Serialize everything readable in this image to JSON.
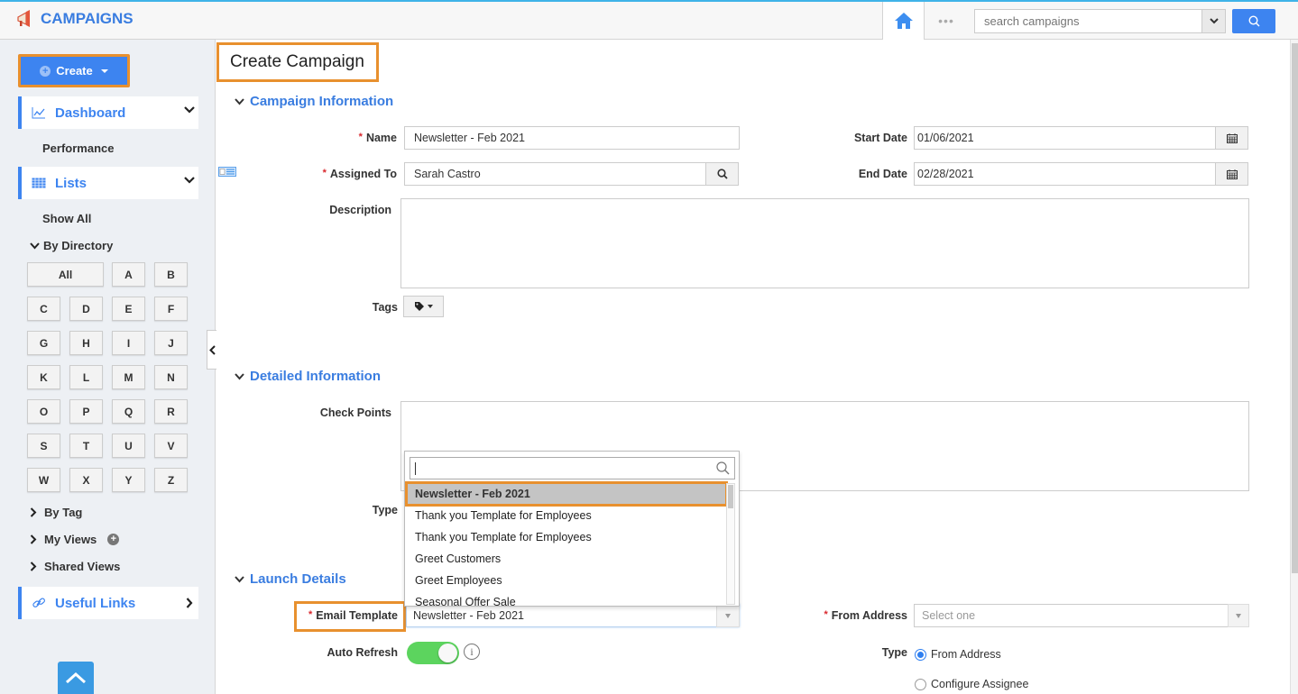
{
  "app": {
    "title": "CAMPAIGNS",
    "icon": "megaphone-icon"
  },
  "topbar": {
    "home_icon": "home-icon",
    "more_icon": "ellipsis-icon",
    "more_label": "•••",
    "search_placeholder": "search campaigns",
    "search_value": "",
    "search_dropdown_icon": "chevron-down-icon",
    "search_button_icon": "search-icon"
  },
  "sidebar": {
    "create_label": "Create",
    "sections": [
      {
        "label": "Dashboard",
        "icon": "line-chart-icon",
        "expanded": true,
        "items": [
          "Performance"
        ]
      },
      {
        "label": "Lists",
        "icon": "grid-table-icon",
        "expanded": true,
        "items": [
          "Show All"
        ]
      }
    ],
    "by_directory_label": "By Directory",
    "letters": [
      "All",
      "A",
      "B",
      "C",
      "D",
      "E",
      "F",
      "G",
      "H",
      "I",
      "J",
      "K",
      "L",
      "M",
      "N",
      "O",
      "P",
      "Q",
      "R",
      "S",
      "T",
      "U",
      "V",
      "W",
      "X",
      "Y",
      "Z"
    ],
    "tree_items": [
      {
        "label": "By Tag"
      },
      {
        "label": "My Views",
        "has_add": true
      },
      {
        "label": "Shared Views"
      }
    ],
    "useful_links_label": "Useful Links",
    "useful_links_icon": "link-icon"
  },
  "main": {
    "page_title": "Create Campaign",
    "sections": {
      "campaign_info": "Campaign Information",
      "detailed_info": "Detailed Information",
      "launch_details": "Launch Details"
    },
    "fields": {
      "name": {
        "label": "Name",
        "required": true,
        "value": "Newsletter - Feb 2021"
      },
      "assigned_to": {
        "label": "Assigned To",
        "required": true,
        "value": "Sarah Castro"
      },
      "start_date": {
        "label": "Start Date",
        "value": "01/06/2021"
      },
      "end_date": {
        "label": "End Date",
        "value": "02/28/2021"
      },
      "description": {
        "label": "Description",
        "value": ""
      },
      "tags": {
        "label": "Tags"
      },
      "check_points": {
        "label": "Check Points",
        "value": ""
      },
      "type": {
        "label": "Type"
      },
      "email_template": {
        "label": "Email Template",
        "required": true,
        "value": "Newsletter - Feb 2021"
      },
      "from_address": {
        "label": "From Address",
        "required": true,
        "placeholder": "Select one"
      },
      "auto_refresh": {
        "label": "Auto Refresh",
        "enabled": true
      },
      "from_type": {
        "label": "Type",
        "options": [
          {
            "label": "From Address",
            "selected": true
          },
          {
            "label": "Configure Assignee",
            "selected": false
          }
        ]
      }
    },
    "template_dropdown": {
      "search_value": "",
      "options": [
        {
          "label": "Newsletter - Feb 2021",
          "selected": true
        },
        {
          "label": "Thank you Template for Employees",
          "selected": false
        },
        {
          "label": "Thank you Template for Employees",
          "selected": false
        },
        {
          "label": "Greet Customers",
          "selected": false
        },
        {
          "label": "Greet Employees",
          "selected": false
        },
        {
          "label": "Seasonal Offer Sale",
          "selected": false
        }
      ]
    }
  },
  "colors": {
    "accent": "#3d84f0",
    "highlight": "#e8902e",
    "toggle_on": "#5cd45e",
    "required": "#d9262c"
  }
}
